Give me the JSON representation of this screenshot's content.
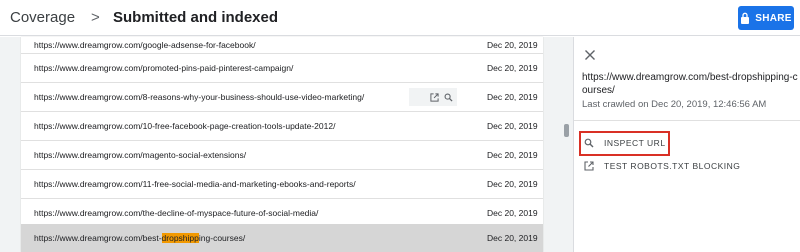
{
  "header": {
    "breadcrumb_root": "Coverage",
    "breadcrumb_separator": ">",
    "title": "Submitted and indexed",
    "share_label": "SHARE",
    "share_icon": "lock-icon",
    "accent_color": "#1a73e8"
  },
  "table": {
    "rows": [
      {
        "url": "https://www.dreamgrow.com/google-adsense-for-facebook/",
        "date": "Dec 20, 2019"
      },
      {
        "url": "https://www.dreamgrow.com/promoted-pins-paid-pinterest-campaign/",
        "date": "Dec 20, 2019"
      },
      {
        "url": "https://www.dreamgrow.com/8-reasons-why-your-business-should-use-video-marketing/",
        "date": "Dec 20, 2019"
      },
      {
        "url": "https://www.dreamgrow.com/10-free-facebook-page-creation-tools-update-2012/",
        "date": "Dec 20, 2019"
      },
      {
        "url": "https://www.dreamgrow.com/magento-social-extensions/",
        "date": "Dec 20, 2019"
      },
      {
        "url": "https://www.dreamgrow.com/11-free-social-media-and-marketing-ebooks-and-reports/",
        "date": "Dec 20, 2019"
      },
      {
        "url": "https://www.dreamgrow.com/the-decline-of-myspace-future-of-social-media/",
        "date": "Dec 20, 2019"
      }
    ],
    "selected_row": {
      "url_prefix": "https://www.dreamgrow.com/best-",
      "url_highlight": "dropshipp",
      "url_suffix": "ing-courses/",
      "date": "Dec 20, 2019"
    },
    "highlight_color": "#f29900"
  },
  "panel": {
    "close_icon": "close-icon",
    "url": "https://www.dreamgrow.com/best-dropshipping-courses/",
    "last_crawled": "Last crawled on Dec 20, 2019, 12:46:56 AM",
    "inspect_label": "INSPECT URL",
    "robots_label": "TEST ROBOTS.TXT BLOCKING"
  }
}
